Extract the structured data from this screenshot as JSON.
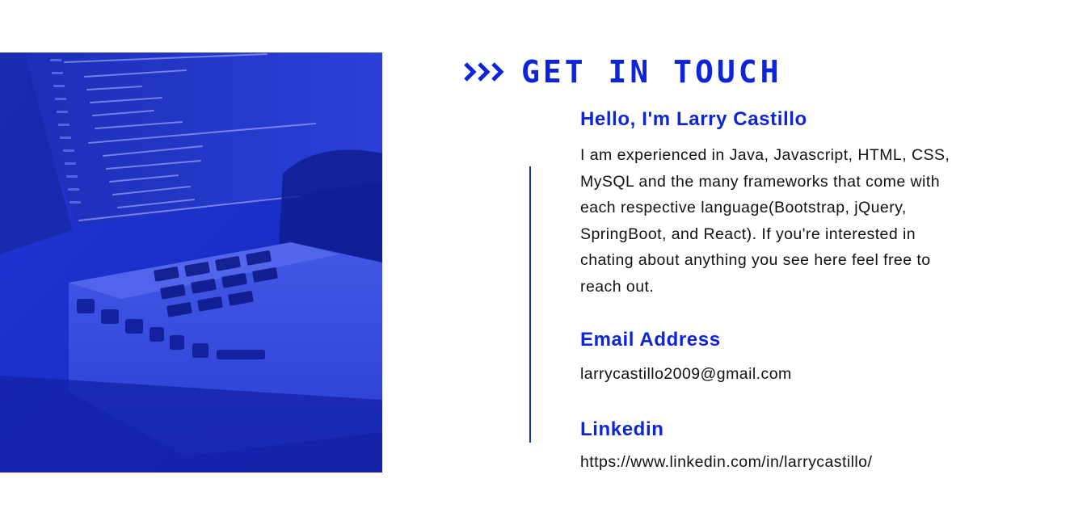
{
  "header": {
    "title": "GET IN TOUCH",
    "icon": "triple-chevron-right-icon",
    "accent_color": "#0d24d9"
  },
  "hero_image": {
    "icon": "laptop-code-photo",
    "tint_color": "#1a2ec8"
  },
  "intro": {
    "heading": "Hello, I'm Larry Castillo",
    "lines": [
      "I am experienced in Java, Javascript, HTML, CSS,",
      "MySQL and the many frameworks that come with",
      "each respective language(Bootstrap, jQuery,",
      "SpringBoot, and React). If you're interested in",
      "chating about anything you see here feel free to",
      "reach out."
    ]
  },
  "email": {
    "heading": "Email Address",
    "value": "larrycastillo2009@gmail.com"
  },
  "linkedin": {
    "heading": "Linkedin",
    "value": "https://www.linkedin.com/in/larrycastillo/"
  }
}
